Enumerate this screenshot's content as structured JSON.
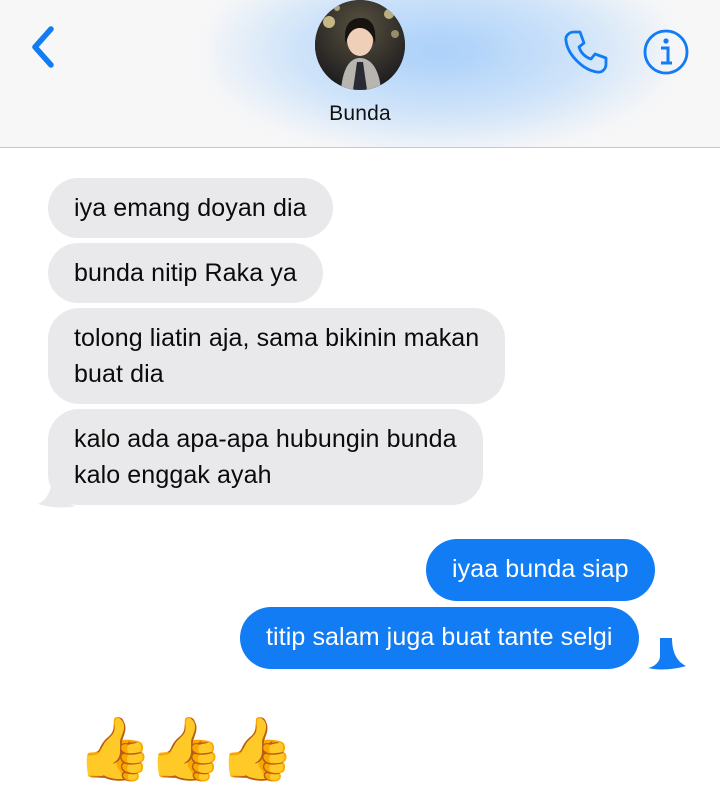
{
  "contact": {
    "name": "Bunda"
  },
  "icons": {
    "back": "chevron-left-icon",
    "call": "phone-icon",
    "info": "info-icon"
  },
  "colors": {
    "accent": "#127cf4",
    "incoming_bubble": "#e9e9eb",
    "outgoing_bubble": "#127cf4"
  },
  "messages": [
    {
      "direction": "incoming",
      "text": "iya emang doyan dia"
    },
    {
      "direction": "incoming",
      "text": "bunda nitip Raka ya"
    },
    {
      "direction": "incoming",
      "lines": [
        "tolong liatin aja, sama bikinin makan",
        "buat dia"
      ]
    },
    {
      "direction": "incoming",
      "lines": [
        "kalo ada apa-apa hubungin bunda",
        "kalo enggak ayah"
      ]
    },
    {
      "direction": "outgoing",
      "text": "iyaa bunda siap"
    },
    {
      "direction": "outgoing",
      "text": "titip salam juga buat tante selgi"
    },
    {
      "direction": "incoming",
      "text": "👍👍👍"
    }
  ]
}
